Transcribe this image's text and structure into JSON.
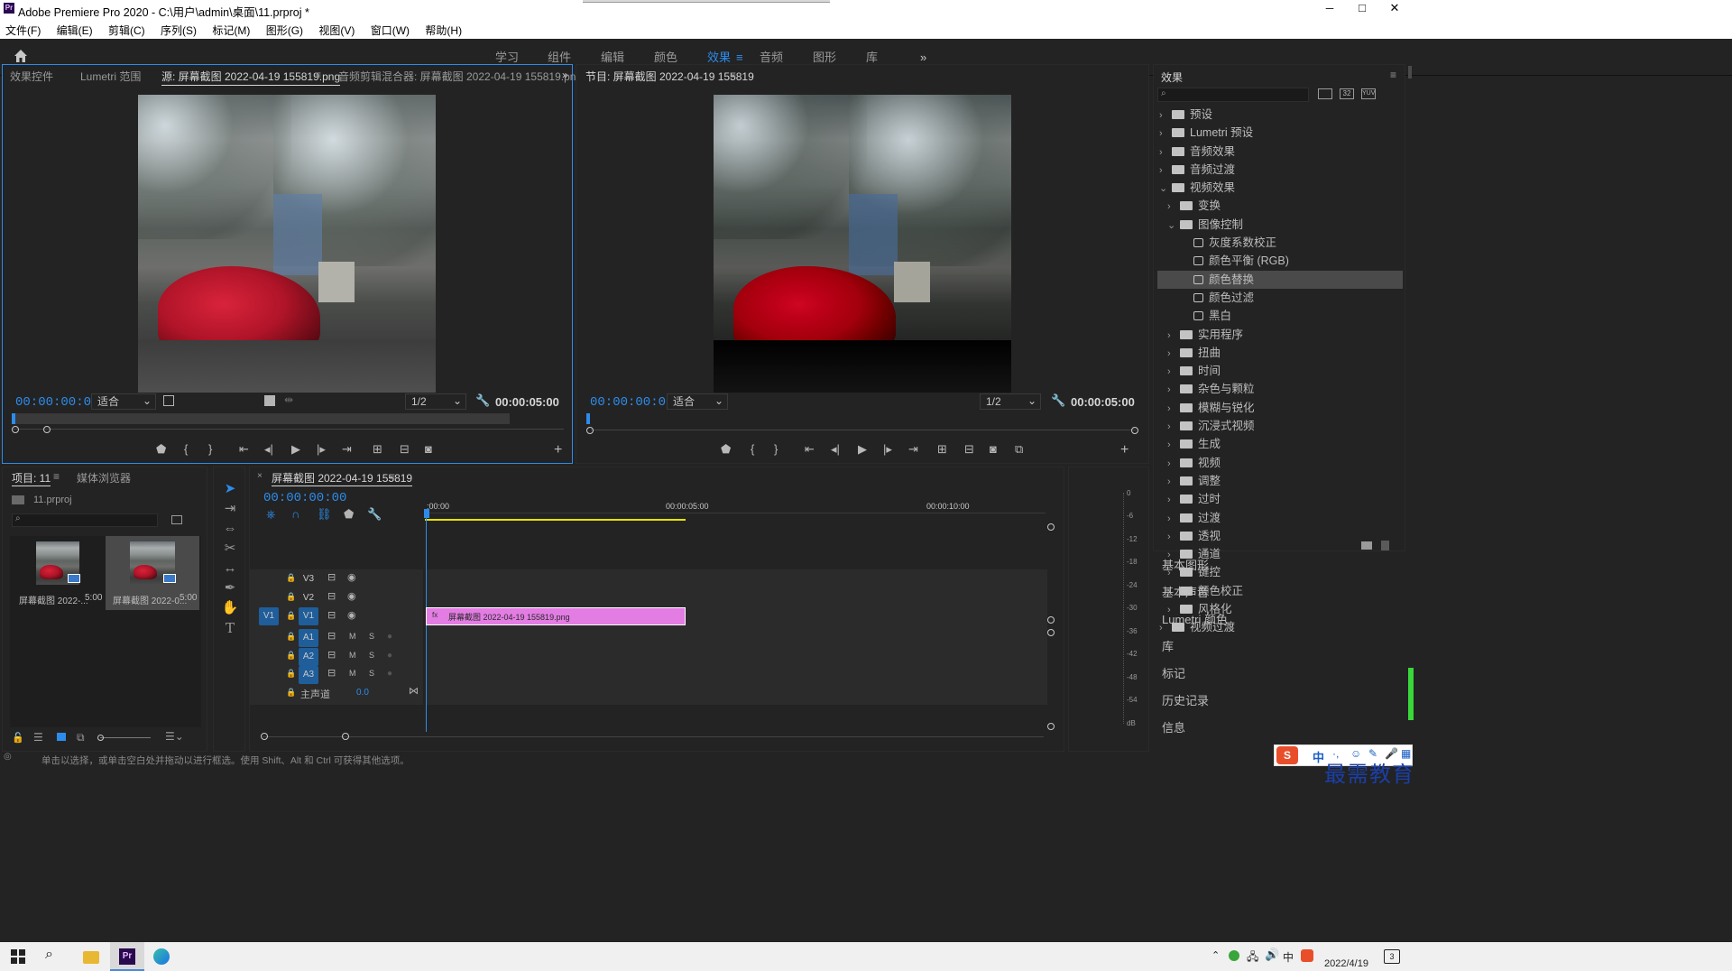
{
  "app": {
    "title": "Adobe Premiere Pro 2020 - C:\\用户\\admin\\桌面\\11.prproj *",
    "window_controls": [
      "─",
      "□",
      "✕"
    ]
  },
  "menu": [
    "文件(F)",
    "编辑(E)",
    "剪辑(C)",
    "序列(S)",
    "标记(M)",
    "图形(G)",
    "视图(V)",
    "窗口(W)",
    "帮助(H)"
  ],
  "workspaces": [
    "学习",
    "组件",
    "编辑",
    "颜色",
    "效果",
    "音频",
    "图形",
    "库"
  ],
  "workspace_active": "效果",
  "source": {
    "tabs": [
      "效果控件",
      "Lumetri 范围",
      "源: 屏幕截图 2022-04-19 155819.png",
      "音频剪辑混合器: 屏幕截图 2022-04-19 155819.png"
    ],
    "timecode": "00:00:00:00",
    "fit": "适合",
    "res": "1/2",
    "duration": "00:00:05:00"
  },
  "program": {
    "tab": "节目: 屏幕截图 2022-04-19 155819",
    "timecode": "00:00:00:00",
    "fit": "适合",
    "res": "1/2",
    "duration": "00:00:05:00"
  },
  "effects": {
    "title": "效果",
    "tree": [
      {
        "label": "预设",
        "level": 0,
        "type": "folder",
        "open": false
      },
      {
        "label": "Lumetri 预设",
        "level": 0,
        "type": "folder",
        "open": false
      },
      {
        "label": "音频效果",
        "level": 0,
        "type": "folder",
        "open": false
      },
      {
        "label": "音频过渡",
        "level": 0,
        "type": "folder",
        "open": false
      },
      {
        "label": "视频效果",
        "level": 0,
        "type": "folder",
        "open": true
      },
      {
        "label": "变换",
        "level": 1,
        "type": "folder",
        "open": false
      },
      {
        "label": "图像控制",
        "level": 1,
        "type": "folder",
        "open": true
      },
      {
        "label": "灰度系数校正",
        "level": 2,
        "type": "effect"
      },
      {
        "label": "颜色平衡 (RGB)",
        "level": 2,
        "type": "effect"
      },
      {
        "label": "颜色替换",
        "level": 2,
        "type": "effect",
        "selected": true
      },
      {
        "label": "颜色过滤",
        "level": 2,
        "type": "effect"
      },
      {
        "label": "黑白",
        "level": 2,
        "type": "effect"
      },
      {
        "label": "实用程序",
        "level": 1,
        "type": "folder",
        "open": false
      },
      {
        "label": "扭曲",
        "level": 1,
        "type": "folder",
        "open": false
      },
      {
        "label": "时间",
        "level": 1,
        "type": "folder",
        "open": false
      },
      {
        "label": "杂色与颗粒",
        "level": 1,
        "type": "folder",
        "open": false
      },
      {
        "label": "模糊与锐化",
        "level": 1,
        "type": "folder",
        "open": false
      },
      {
        "label": "沉浸式视频",
        "level": 1,
        "type": "folder",
        "open": false
      },
      {
        "label": "生成",
        "level": 1,
        "type": "folder",
        "open": false
      },
      {
        "label": "视频",
        "level": 1,
        "type": "folder",
        "open": false
      },
      {
        "label": "调整",
        "level": 1,
        "type": "folder",
        "open": false
      },
      {
        "label": "过时",
        "level": 1,
        "type": "folder",
        "open": false
      },
      {
        "label": "过渡",
        "level": 1,
        "type": "folder",
        "open": false
      },
      {
        "label": "透视",
        "level": 1,
        "type": "folder",
        "open": false
      },
      {
        "label": "通道",
        "level": 1,
        "type": "folder",
        "open": false
      },
      {
        "label": "键控",
        "level": 1,
        "type": "folder",
        "open": false
      },
      {
        "label": "颜色校正",
        "level": 1,
        "type": "folder",
        "open": false
      },
      {
        "label": "风格化",
        "level": 1,
        "type": "folder",
        "open": false
      },
      {
        "label": "视频过渡",
        "level": 0,
        "type": "folder",
        "open": false
      }
    ],
    "side_panels": [
      "基本图形",
      "基本声音",
      "Lumetri 颜色",
      "库",
      "标记",
      "历史记录",
      "信息"
    ]
  },
  "project": {
    "tabs": [
      "项目: 11",
      "媒体浏览器"
    ],
    "file": "11.prproj",
    "items": [
      {
        "name": "屏幕截图 2022-...",
        "duration": "5:00"
      },
      {
        "name": "屏幕截图 2022-0...",
        "duration": "5:00"
      }
    ]
  },
  "timeline": {
    "tab": "屏幕截图 2022-04-19 155819",
    "timecode": "00:00:00:00",
    "ruler": [
      ":00:00",
      "00:00:05:00",
      "00:00:10:00"
    ],
    "video_tracks": [
      "V3",
      "V2",
      "V1"
    ],
    "audio_tracks": [
      "A1",
      "A2",
      "A3"
    ],
    "source_patch": "V1",
    "master_label": "主声道",
    "master_value": "0.0",
    "clip_name": "屏幕截图 2022-04-19 155819.png",
    "clip_color": "#e37ce3",
    "mute": "M",
    "solo": "S"
  },
  "meter": {
    "scale": [
      "0",
      "-6",
      "-12",
      "-18",
      "-24",
      "-30",
      "-36",
      "-42",
      "-48",
      "-54",
      "dB"
    ]
  },
  "status": {
    "text": "单击以选择，或单击空白处并拖动以进行框选。使用 Shift、Alt 和 Ctrl 可获得其他选项。"
  },
  "taskbar": {
    "date": "2022/4/19",
    "ime": "中",
    "watermark": "最需教育",
    "notif": "3"
  },
  "colors": {
    "accent": "#2d8ceb",
    "clip": "#e37ce3",
    "work_area": "#e5e500"
  }
}
